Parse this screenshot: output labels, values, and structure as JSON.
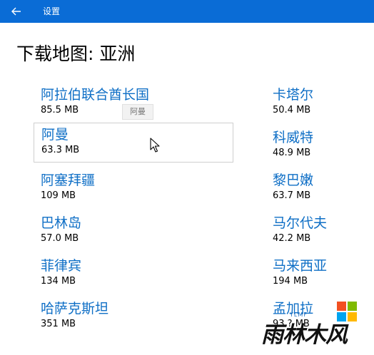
{
  "titlebar": {
    "app_title": "设置",
    "back_icon": "back-arrow-icon",
    "background": "#0a6cd6"
  },
  "page": {
    "title": "下载地图: 亚洲"
  },
  "regions": {
    "left": [
      {
        "name": "阿拉伯联合酋长国",
        "size": "85.5 MB"
      },
      {
        "name": "阿曼",
        "size": "63.3 MB",
        "selected": true
      },
      {
        "name": "阿塞拜疆",
        "size": "109 MB"
      },
      {
        "name": "巴林岛",
        "size": "57.0 MB"
      },
      {
        "name": "菲律宾",
        "size": "134 MB"
      },
      {
        "name": "哈萨克斯坦",
        "size": "351 MB"
      }
    ],
    "right": [
      {
        "name": "卡塔尔",
        "size": "50.4 MB"
      },
      {
        "name": "科威特",
        "size": "48.9 MB"
      },
      {
        "name": "黎巴嫩",
        "size": "63.7 MB"
      },
      {
        "name": "马尔代夫",
        "size": "42.2 MB"
      },
      {
        "name": "马来西亚",
        "size": "194 MB"
      },
      {
        "name": "孟加拉",
        "size": "93.? MB"
      }
    ]
  },
  "tooltip": {
    "text": "阿曼"
  },
  "watermark": {
    "text": "雨林木风",
    "sub": "YLMF"
  },
  "colors": {
    "accent": "#0f6fc6",
    "selection_border": "#cfcfcf"
  }
}
